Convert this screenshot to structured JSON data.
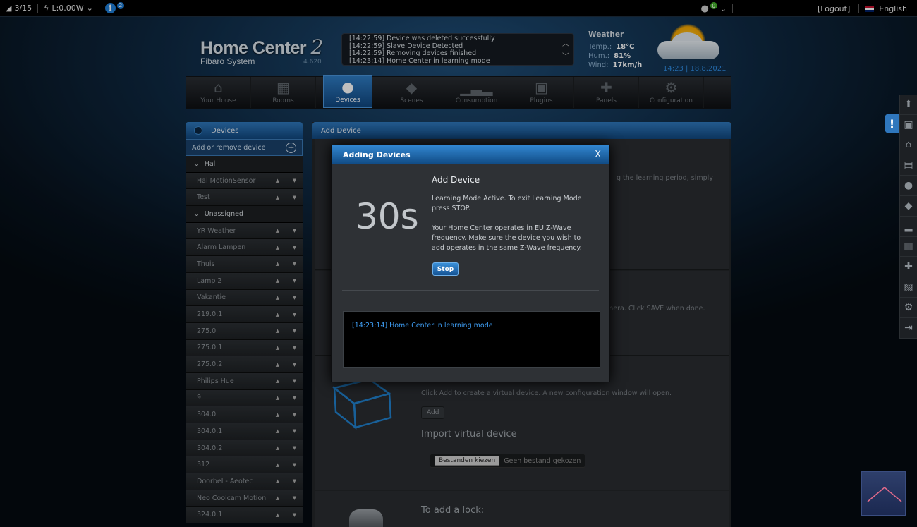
{
  "topbar": {
    "devices_count": "3/15",
    "power": "L:0.00W",
    "notifications_count": "2",
    "user_badge": "0",
    "logout": "[Logout]",
    "language": "English"
  },
  "header": {
    "logo_title": "Home Center",
    "logo_number": "2",
    "logo_sub": "Fibaro System",
    "version": "4.620",
    "log_lines": [
      "[14:22:59] Device was deleted successfully",
      "[14:22:59] Slave Device Detected",
      "[14:22:59] Removing devices finished",
      "[14:23:14] Home Center in learning mode"
    ],
    "weather": {
      "title": "Weather",
      "temp_label": "Temp.:",
      "temp": "18°C",
      "hum_label": "Hum.:",
      "hum": "81%",
      "wind_label": "Wind:",
      "wind": "17km/h",
      "datetime": "14:23 | 18.8.2021"
    }
  },
  "nav": {
    "tabs": [
      {
        "label": "Your House",
        "icon": "house-icon",
        "glyph": "⌂"
      },
      {
        "label": "Rooms",
        "icon": "rooms-icon",
        "glyph": "▦"
      },
      {
        "label": "Devices",
        "icon": "bulb-icon",
        "glyph": "●"
      },
      {
        "label": "Scenes",
        "icon": "scenes-icon",
        "glyph": "◆"
      },
      {
        "label": "Consumption",
        "icon": "chart-icon",
        "glyph": "▁▃▂"
      },
      {
        "label": "Plugins",
        "icon": "plugins-icon",
        "glyph": "▣"
      },
      {
        "label": "Panels",
        "icon": "puzzle-icon",
        "glyph": "✚"
      },
      {
        "label": "Configuration",
        "icon": "gear-icon",
        "glyph": "⚙"
      }
    ]
  },
  "sidebar": {
    "title": "Devices",
    "add_remove": "Add or remove device",
    "sections": [
      {
        "name": "Hal",
        "items": [
          "Hal MotionSensor",
          "Test"
        ]
      },
      {
        "name": "Unassigned",
        "items": [
          "YR Weather",
          "Alarm Lampen",
          "Thuis",
          "Lamp 2",
          "Vakantie",
          "219.0.1",
          "275.0",
          "275.0.1",
          "275.0.2",
          "Philips Hue",
          "9",
          "304.0",
          "304.0.1",
          "304.0.2",
          "312",
          "Doorbel - Aeotec",
          "Neo Coolcam Motion",
          "324.0.1"
        ]
      }
    ]
  },
  "main": {
    "title": "Add Device",
    "learning_tail": "g the learning period, simply",
    "camera_tail": "mera. Click SAVE when done.",
    "virtual_text": "Click Add to create a virtual device. A new configuration window will open.",
    "add_btn": "Add",
    "import_title": "Import virtual device",
    "file_btn": "Bestanden kiezen",
    "file_none": "Geen bestand gekozen",
    "lock_title": "To add a lock:"
  },
  "modal": {
    "title": "Adding Devices",
    "close": "X",
    "counter": "30s",
    "heading": "Add Device",
    "p1": "Learning Mode Active. To exit Learning Mode press STOP.",
    "p2": "Your Home Center operates in EU Z-Wave frequency. Make sure the device you wish to add operates in the same Z-Wave frequency.",
    "stop": "Stop",
    "log": "[14:23:14] Home Center in learning mode"
  },
  "colors": {
    "accent": "#2f78bc",
    "log_text": "#3d9bf0"
  }
}
